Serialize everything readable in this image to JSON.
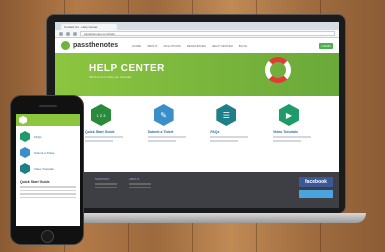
{
  "browser": {
    "tab_title": "Contact Us - Help Center",
    "url": "passthenotes.com/help"
  },
  "site": {
    "logo_text": "passthenotes",
    "nav": [
      "HOME",
      "ABOUT",
      "SOLUTIONS",
      "RESOURCES",
      "HELP CENTER",
      "BLOG"
    ],
    "login_label": "LOGIN"
  },
  "hero": {
    "title": "HELP CENTER",
    "subtitle": "We're here to help you succeed"
  },
  "cards": [
    {
      "icon": "steps-icon",
      "glyph": "1 2 3",
      "title": "Quick Start Guide"
    },
    {
      "icon": "ticket-icon",
      "glyph": "✎",
      "title": "Submit a Ticket"
    },
    {
      "icon": "faq-list-icon",
      "glyph": "☰",
      "title": "FAQs"
    },
    {
      "icon": "video-icon",
      "glyph": "▶",
      "title": "Video Tutorials"
    }
  ],
  "footer": {
    "columns": [
      "SOLUTIONS",
      "SUPPORT",
      "ABOUT"
    ],
    "facebook_label": "facebook"
  },
  "phone": {
    "items": [
      "FAQs",
      "Submit a Ticket",
      "Video Tutorials"
    ],
    "article_title": "Quick Start Guide"
  }
}
